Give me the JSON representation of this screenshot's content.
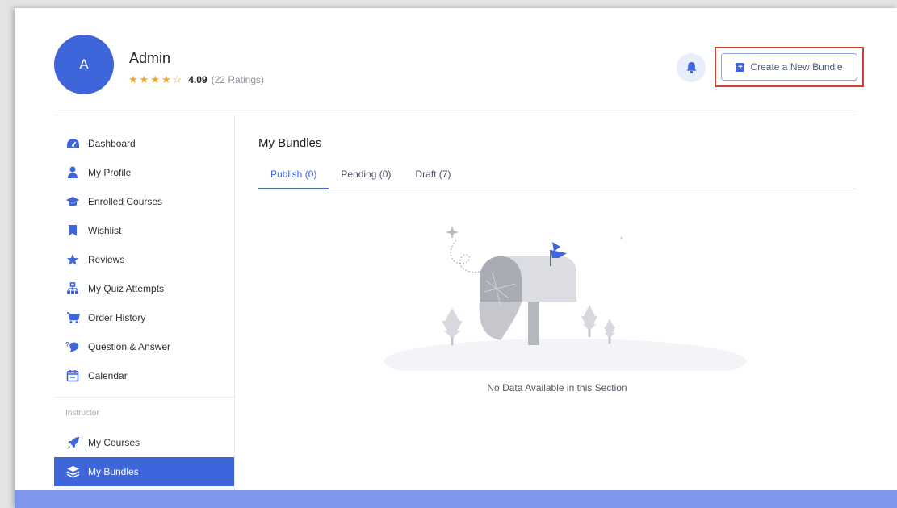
{
  "profile": {
    "avatar_initial": "A",
    "name": "Admin",
    "stars": [
      "★",
      "★",
      "★",
      "★",
      "☆"
    ],
    "rating_value": "4.09",
    "rating_count": "(22 Ratings)"
  },
  "header": {
    "create_button_label": "Create a New Bundle",
    "create_button_icon": "plus-square-icon",
    "notification_icon": "bell-icon"
  },
  "sidebar": {
    "items": [
      {
        "label": "Dashboard",
        "icon": "dashboard-icon"
      },
      {
        "label": "My Profile",
        "icon": "user-icon"
      },
      {
        "label": "Enrolled Courses",
        "icon": "graduation-cap-icon"
      },
      {
        "label": "Wishlist",
        "icon": "bookmark-icon"
      },
      {
        "label": "Reviews",
        "icon": "star-icon"
      },
      {
        "label": "My Quiz Attempts",
        "icon": "sitemap-icon"
      },
      {
        "label": "Order History",
        "icon": "cart-icon"
      },
      {
        "label": "Question & Answer",
        "icon": "question-answer-icon"
      },
      {
        "label": "Calendar",
        "icon": "calendar-icon"
      }
    ],
    "section_label": "Instructor",
    "instructor_items": [
      {
        "label": "My Courses",
        "icon": "rocket-icon"
      },
      {
        "label": "My Bundles",
        "icon": "layers-icon",
        "active": true
      }
    ]
  },
  "main": {
    "title": "My Bundles",
    "tabs": [
      {
        "label": "Publish (0)",
        "active": true
      },
      {
        "label": "Pending (0)"
      },
      {
        "label": "Draft (7)"
      }
    ],
    "empty_message": "No Data Available in this Section"
  },
  "colors": {
    "accent": "#3f65db",
    "star": "#f0a62c",
    "highlight_border": "#d13f2f",
    "bottom_bar": "#7f97ea"
  }
}
